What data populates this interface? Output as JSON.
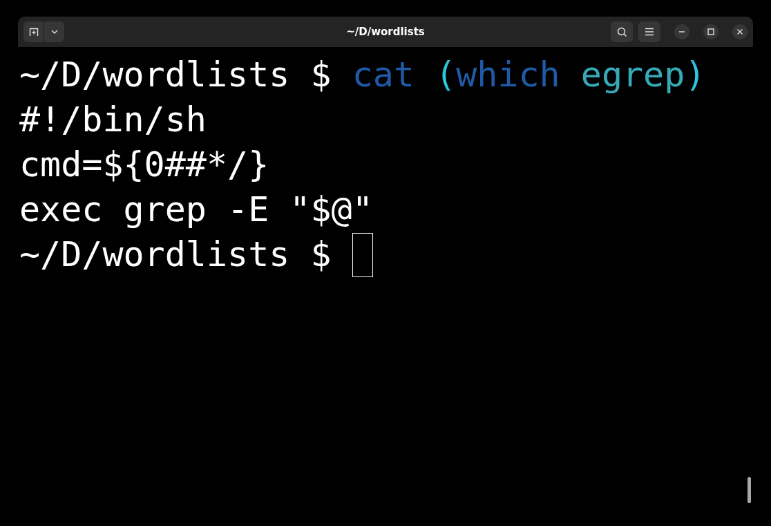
{
  "window": {
    "title": "~/D/wordlists"
  },
  "terminal": {
    "lines": [
      {
        "cursor": false,
        "segments": [
          {
            "text": "~/D/wordlists $ ",
            "color": "#ffffff"
          },
          {
            "text": "cat ",
            "color": "#1f5aa6"
          },
          {
            "text": "(",
            "color": "#2ec4dc"
          },
          {
            "text": "which ",
            "color": "#1f5aa6"
          },
          {
            "text": "egrep",
            "color": "#36aab8"
          },
          {
            "text": ")",
            "color": "#2ec4dc"
          }
        ]
      },
      {
        "cursor": false,
        "segments": [
          {
            "text": "#!/bin/sh",
            "color": "#ffffff"
          }
        ]
      },
      {
        "cursor": false,
        "segments": [
          {
            "text": "cmd=${0##*/}",
            "color": "#ffffff"
          }
        ]
      },
      {
        "cursor": false,
        "segments": [
          {
            "text": "exec grep -E \"$@\"",
            "color": "#ffffff"
          }
        ]
      },
      {
        "cursor": true,
        "segments": [
          {
            "text": "~/D/wordlists $ ",
            "color": "#ffffff"
          }
        ]
      }
    ]
  }
}
